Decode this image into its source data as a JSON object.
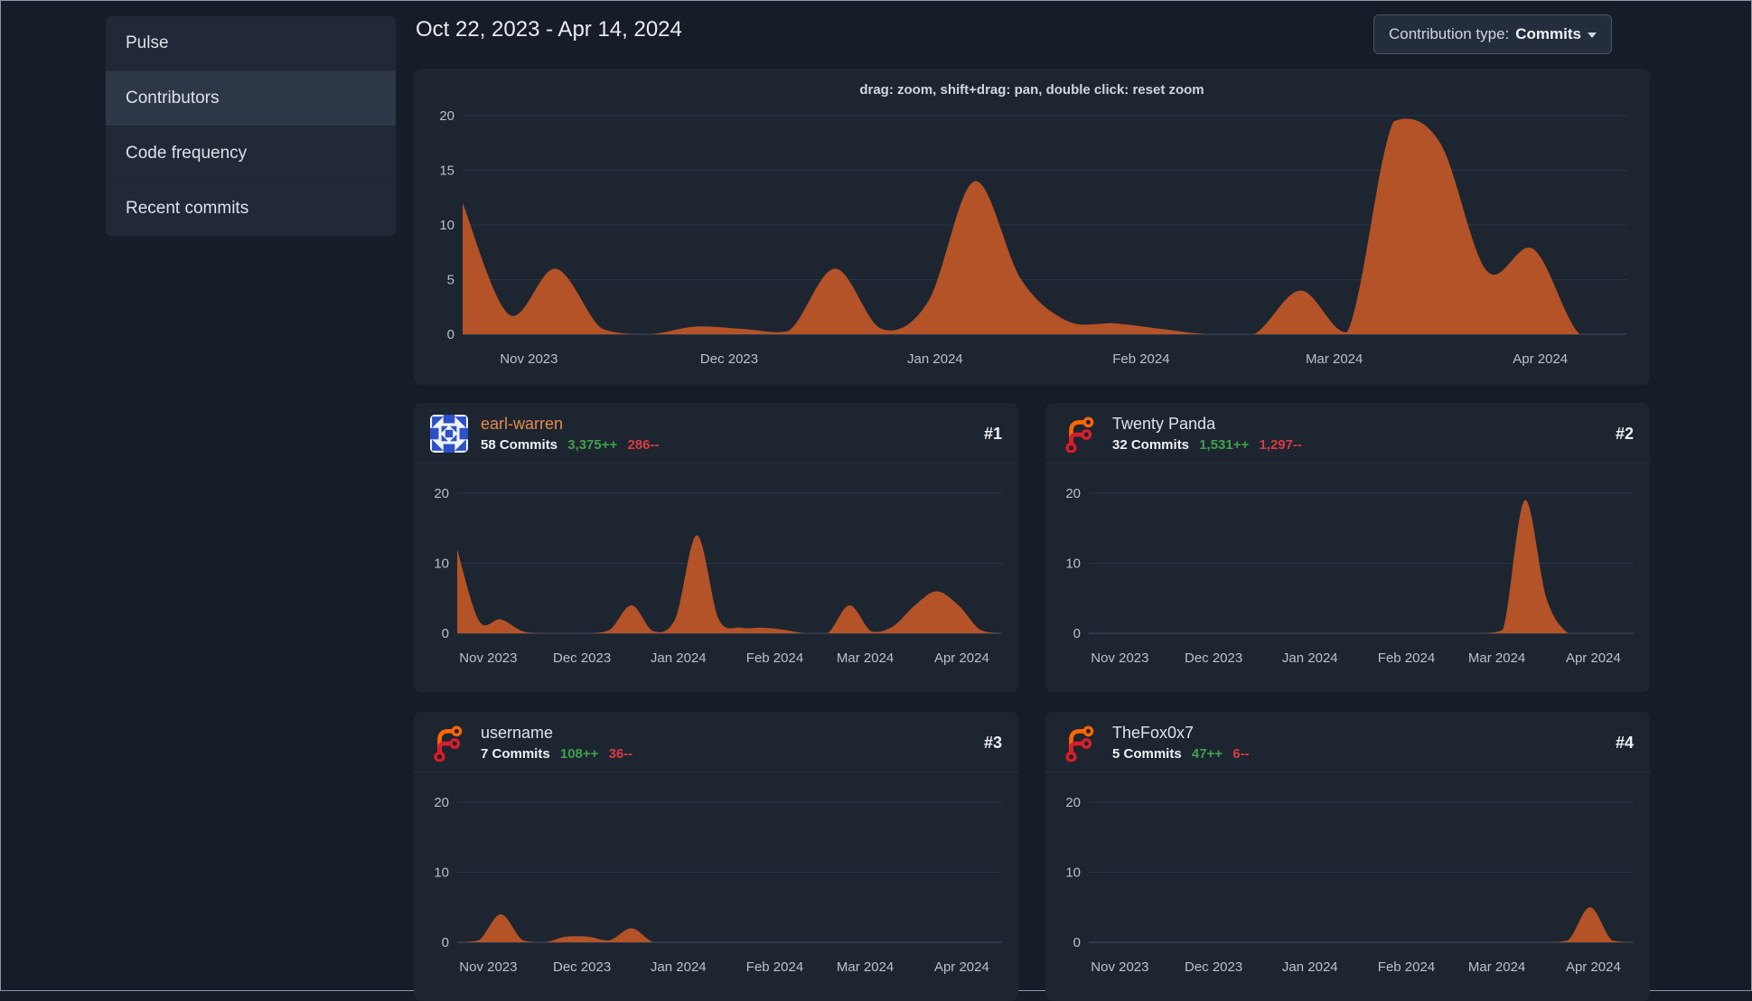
{
  "sidebar": {
    "items": [
      {
        "label": "Pulse",
        "active": false
      },
      {
        "label": "Contributors",
        "active": true
      },
      {
        "label": "Code frequency",
        "active": false
      },
      {
        "label": "Recent commits",
        "active": false
      }
    ]
  },
  "header": {
    "date_range": "Oct 22, 2023 - Apr 14, 2024",
    "contribution_type_label": "Contribution type:",
    "contribution_type_value": "Commits"
  },
  "main_chart": {
    "hint": "drag: zoom, shift+drag: pan, double click: reset zoom"
  },
  "contributors": [
    {
      "name": "earl-warren",
      "commits": "58 Commits",
      "additions": "3,375++",
      "deletions": "286--",
      "rank": "#1",
      "avatar": "identicon",
      "name_color": "#e8894c"
    },
    {
      "name": "Twenty Panda",
      "commits": "32 Commits",
      "additions": "1,531++",
      "deletions": "1,297--",
      "rank": "#2",
      "avatar": "forgejo-logo",
      "name_color": "#dde3eb"
    },
    {
      "name": "username",
      "commits": "7 Commits",
      "additions": "108++",
      "deletions": "36--",
      "rank": "#3",
      "avatar": "forgejo-logo",
      "name_color": "#dde3eb"
    },
    {
      "name": "TheFox0x7",
      "commits": "5 Commits",
      "additions": "47++",
      "deletions": "6--",
      "rank": "#4",
      "avatar": "forgejo-logo",
      "name_color": "#dde3eb"
    }
  ],
  "colors": {
    "area_fill": "#b35327",
    "grid_line": "#2b3645",
    "axis_line": "#3f4c5f",
    "tick_text": "#b8c1cb",
    "additions_green": "#41a04c",
    "deletions_red": "#d93b40"
  },
  "chart_data": [
    {
      "name": "overall-contributions",
      "type": "area",
      "x_unit": "week",
      "x_range": [
        "Oct 22, 2023",
        "Apr 14, 2024"
      ],
      "x_tick_labels": [
        "Nov 2023",
        "Dec 2023",
        "Jan 2024",
        "Feb 2024",
        "Mar 2024",
        "Apr 2024"
      ],
      "x_tick_positions": [
        0.057,
        0.229,
        0.406,
        0.583,
        0.749,
        0.926
      ],
      "ylim": [
        0,
        20
      ],
      "yticks": [
        0,
        5,
        10,
        15,
        20
      ],
      "values": [
        12,
        1.8,
        6,
        0.5,
        0,
        0.7,
        0.5,
        0.3,
        6,
        0.5,
        3,
        14,
        5,
        1.2,
        1,
        0.5,
        0,
        0,
        4,
        0.2,
        19.5,
        17.5,
        5.8,
        7.8,
        0,
        0
      ]
    },
    {
      "name": "earl-warren-commits",
      "type": "area",
      "x_unit": "week",
      "x_tick_labels": [
        "Nov 2023",
        "Dec 2023",
        "Jan 2024",
        "Feb 2024",
        "Mar 2024",
        "Apr 2024"
      ],
      "x_tick_positions": [
        0.057,
        0.229,
        0.406,
        0.583,
        0.749,
        0.926
      ],
      "ylim": [
        0,
        20
      ],
      "yticks": [
        0,
        10,
        20
      ],
      "values": [
        12,
        1.8,
        2,
        0.3,
        0,
        0,
        0,
        0.5,
        4,
        0.3,
        2,
        14,
        2,
        0.8,
        0.8,
        0.5,
        0,
        0,
        4,
        0.3,
        1,
        4,
        6,
        4,
        0.5,
        0
      ]
    },
    {
      "name": "twenty-panda-commits",
      "type": "area",
      "x_unit": "week",
      "x_tick_labels": [
        "Nov 2023",
        "Dec 2023",
        "Jan 2024",
        "Feb 2024",
        "Mar 2024",
        "Apr 2024"
      ],
      "x_tick_positions": [
        0.057,
        0.229,
        0.406,
        0.583,
        0.749,
        0.926
      ],
      "ylim": [
        0,
        20
      ],
      "yticks": [
        0,
        10,
        20
      ],
      "values": [
        0,
        0,
        0,
        0,
        0,
        0,
        0,
        0,
        0,
        0,
        0,
        0,
        0,
        0,
        0,
        0,
        0,
        0,
        0,
        0.5,
        19,
        5,
        0,
        0,
        0,
        0
      ]
    },
    {
      "name": "username-commits",
      "type": "area",
      "x_unit": "week",
      "x_tick_labels": [
        "Nov 2023",
        "Dec 2023",
        "Jan 2024",
        "Feb 2024",
        "Mar 2024",
        "Apr 2024"
      ],
      "x_tick_positions": [
        0.057,
        0.229,
        0.406,
        0.583,
        0.749,
        0.926
      ],
      "ylim": [
        0,
        20
      ],
      "yticks": [
        0,
        10,
        20
      ],
      "values": [
        0,
        0.3,
        4,
        0.3,
        0,
        0.8,
        0.8,
        0.3,
        2,
        0,
        0,
        0,
        0,
        0,
        0,
        0,
        0,
        0,
        0,
        0,
        0,
        0,
        0,
        0,
        0,
        0
      ]
    },
    {
      "name": "thefox0x7-commits",
      "type": "area",
      "x_unit": "week",
      "x_tick_labels": [
        "Nov 2023",
        "Dec 2023",
        "Jan 2024",
        "Feb 2024",
        "Mar 2024",
        "Apr 2024"
      ],
      "x_tick_positions": [
        0.057,
        0.229,
        0.406,
        0.583,
        0.749,
        0.926
      ],
      "ylim": [
        0,
        20
      ],
      "yticks": [
        0,
        10,
        20
      ],
      "values": [
        0,
        0,
        0,
        0,
        0,
        0,
        0,
        0,
        0,
        0,
        0,
        0,
        0,
        0,
        0,
        0,
        0,
        0,
        0,
        0,
        0,
        0,
        0.3,
        5,
        0.3,
        0
      ]
    }
  ]
}
